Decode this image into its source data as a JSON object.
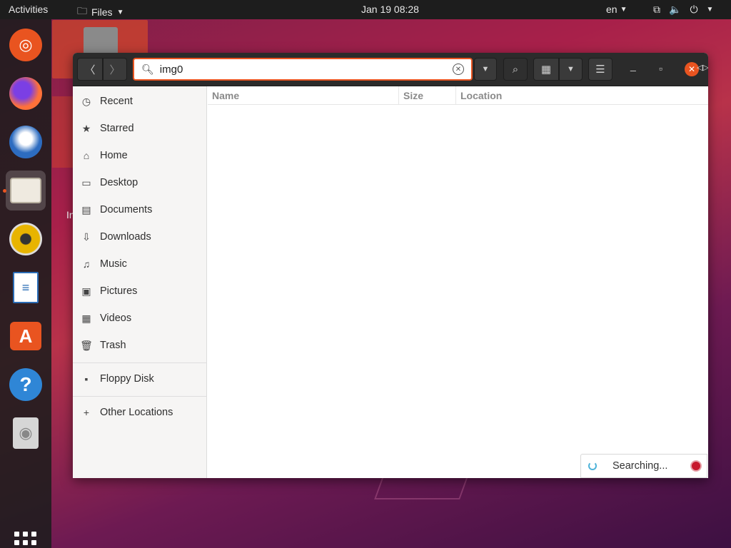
{
  "topbar": {
    "activities": "Activities",
    "app_menu": "Files",
    "clock": "Jan 19  08:28",
    "lang": "en"
  },
  "dock": {
    "items": [
      "ubuntu-icon",
      "firefox-icon",
      "thunderbird-icon",
      "files-icon",
      "rhythmbox-icon",
      "libreoffice-writer-icon",
      "software-icon",
      "help-icon",
      "disc-icon"
    ]
  },
  "desktop": {
    "fragment_label": "In"
  },
  "window": {
    "search": {
      "value": "img0",
      "placeholder": ""
    },
    "sidebar": {
      "items": [
        {
          "label": "Recent",
          "icon": "clock-icon"
        },
        {
          "label": "Starred",
          "icon": "star-icon"
        },
        {
          "label": "Home",
          "icon": "home-icon"
        },
        {
          "label": "Desktop",
          "icon": "desktop-icon"
        },
        {
          "label": "Documents",
          "icon": "document-icon"
        },
        {
          "label": "Downloads",
          "icon": "download-icon"
        },
        {
          "label": "Music",
          "icon": "music-icon"
        },
        {
          "label": "Pictures",
          "icon": "picture-icon"
        },
        {
          "label": "Videos",
          "icon": "video-icon"
        },
        {
          "label": "Trash",
          "icon": "trash-icon"
        }
      ],
      "devices": [
        {
          "label": "Floppy Disk",
          "icon": "floppy-icon"
        }
      ],
      "other": [
        {
          "label": "Other Locations",
          "icon": "plus-icon"
        }
      ]
    },
    "columns": {
      "name": "Name",
      "size": "Size",
      "location": "Location"
    },
    "status": "Searching..."
  },
  "colors": {
    "accent": "#e95420",
    "headerbar": "#2b2b2b",
    "stop": "#c7162b"
  }
}
